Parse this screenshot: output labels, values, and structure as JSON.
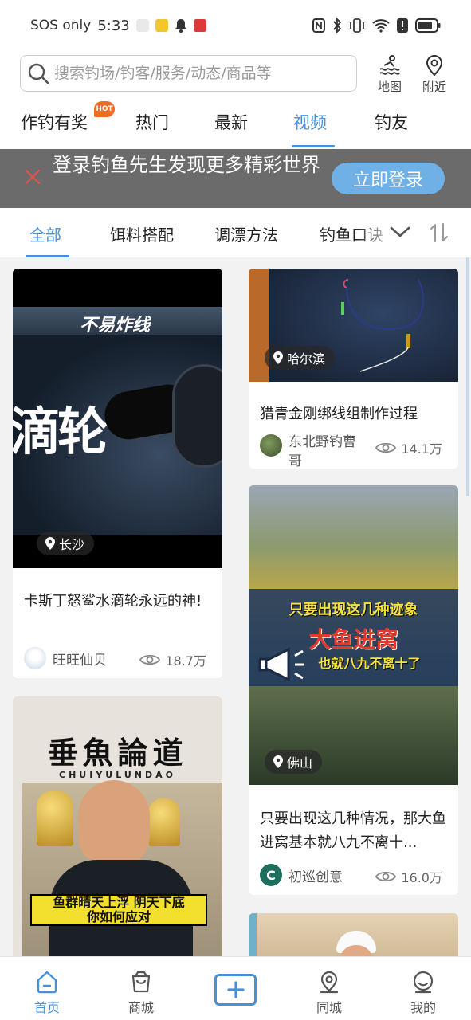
{
  "status_bar": {
    "carrier": "SOS only",
    "time": "5:33"
  },
  "search": {
    "placeholder": "搜索钓场/钓客/服务/动态/商品等"
  },
  "top_actions": [
    {
      "label": "地图",
      "icon": "map-fishing-icon"
    },
    {
      "label": "附近",
      "icon": "location-pin-icon"
    }
  ],
  "main_tabs": [
    {
      "label": "作钓有奖",
      "badge": "HOT"
    },
    {
      "label": "热门"
    },
    {
      "label": "最新"
    },
    {
      "label": "视频",
      "active": true
    },
    {
      "label": "钓友"
    }
  ],
  "login_banner": {
    "text": "登录钓鱼先生发现更多精彩世界",
    "button": "立即登录"
  },
  "sub_tabs": [
    {
      "label": "全部",
      "active": true
    },
    {
      "label": "饵料搭配"
    },
    {
      "label": "调漂方法"
    },
    {
      "label": "钓鱼口诀"
    }
  ],
  "videos": [
    {
      "location": "长沙",
      "title": "卡斯丁怒鲨水滴轮永远的神!",
      "author": "旺旺仙贝",
      "views": "18.7万",
      "cover_text": "不易炸线",
      "cover_big_text": "滴轮"
    },
    {
      "location": "哈尔滨",
      "title": "猎青金刚绑线组制作过程",
      "author": "东北野钓曹哥",
      "views": "14.1万"
    },
    {
      "location": "佛山",
      "title": "只要出现这几种情况，那大鱼进窝基本就八九不离十...",
      "author": "初巡创意",
      "views": "16.0万",
      "cover_lines": [
        "只要出现这几种迹象",
        "大鱼进窝",
        "也就八九不离十了"
      ]
    },
    {
      "cover_title": "垂魚論道",
      "cover_subtitle": "CHUIYULUNDAO",
      "cover_caption_1": "鱼群晴天上浮 阴天下底",
      "cover_caption_2": "你如何应对"
    }
  ],
  "bottom_nav": [
    {
      "label": "首页",
      "active": true
    },
    {
      "label": "商城"
    },
    {
      "label": "同城"
    },
    {
      "label": "我的"
    }
  ],
  "colors": {
    "accent": "#4a90d9",
    "hot": "#ee6c24",
    "banner_bg": "#6b6b6b",
    "login_button": "#6fb1e6"
  }
}
